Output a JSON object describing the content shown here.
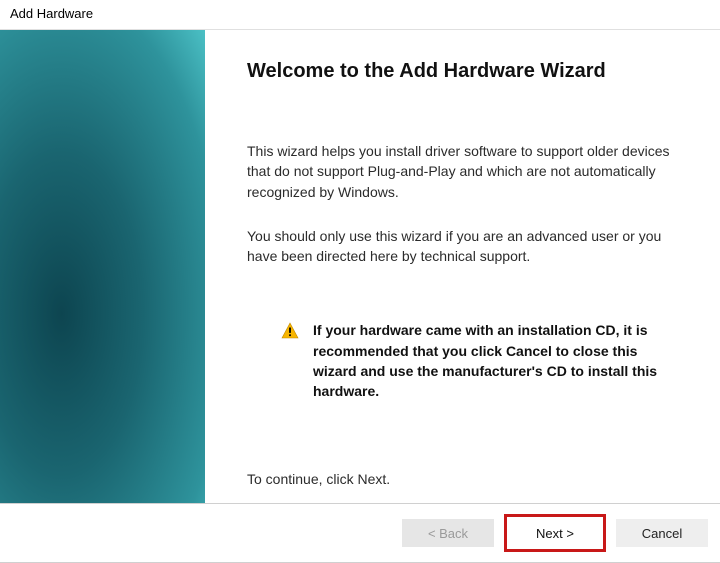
{
  "window": {
    "title": "Add Hardware"
  },
  "main": {
    "heading": "Welcome to the Add Hardware Wizard",
    "paragraph1": "This wizard helps you install driver software to support older devices that do not support Plug-and-Play and which are not automatically recognized by Windows.",
    "paragraph2": "You should only use this wizard if you are an advanced user or you have been directed here by technical support.",
    "warning": "If your hardware came with an installation CD, it is recommended that you click Cancel to close this wizard and use the manufacturer's CD to install this hardware.",
    "continue_hint": "To continue, click Next."
  },
  "footer": {
    "back_label": "< Back",
    "next_label": "Next >",
    "cancel_label": "Cancel"
  }
}
